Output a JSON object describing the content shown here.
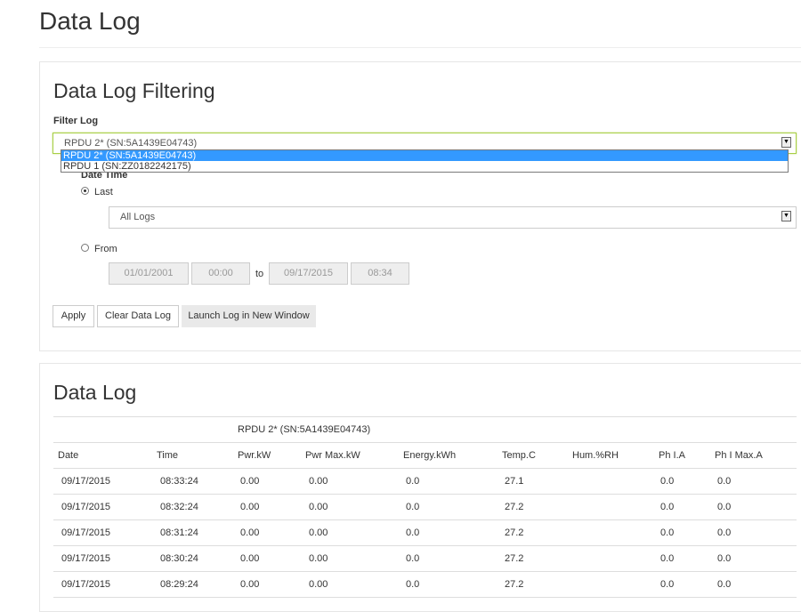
{
  "page": {
    "title": "Data Log"
  },
  "filtering": {
    "title": "Data Log Filtering",
    "filter_label": "Filter Log",
    "selected_device": "RPDU 2* (SN:5A1439E04743)",
    "options": [
      "RPDU 2* (SN:5A1439E04743)",
      "RPDU 1 (SN:ZZ0182242175)"
    ],
    "date_time_label": "Date Time",
    "last_label": "Last",
    "last_checked": true,
    "last_value": "All Logs",
    "from_label": "From",
    "from_date": "01/01/2001",
    "from_time": "00:00",
    "to_label": "to",
    "to_date": "09/17/2015",
    "to_time": "08:34",
    "buttons": {
      "apply": "Apply",
      "clear": "Clear Data Log",
      "launch": "Launch Log in New Window"
    }
  },
  "log": {
    "title": "Data Log",
    "device": "RPDU 2* (SN:5A1439E04743)",
    "columns": [
      "Date",
      "Time",
      "Pwr.kW",
      "Pwr Max.kW",
      "Energy.kWh",
      "Temp.C",
      "Hum.%RH",
      "Ph I.A",
      "Ph I Max.A"
    ],
    "rows": [
      [
        "09/17/2015",
        "08:33:24",
        "0.00",
        "0.00",
        "0.0",
        "27.1",
        "",
        "0.0",
        "0.0"
      ],
      [
        "09/17/2015",
        "08:32:24",
        "0.00",
        "0.00",
        "0.0",
        "27.2",
        "",
        "0.0",
        "0.0"
      ],
      [
        "09/17/2015",
        "08:31:24",
        "0.00",
        "0.00",
        "0.0",
        "27.2",
        "",
        "0.0",
        "0.0"
      ],
      [
        "09/17/2015",
        "08:30:24",
        "0.00",
        "0.00",
        "0.0",
        "27.2",
        "",
        "0.0",
        "0.0"
      ],
      [
        "09/17/2015",
        "08:29:24",
        "0.00",
        "0.00",
        "0.0",
        "27.2",
        "",
        "0.0",
        "0.0"
      ]
    ]
  }
}
